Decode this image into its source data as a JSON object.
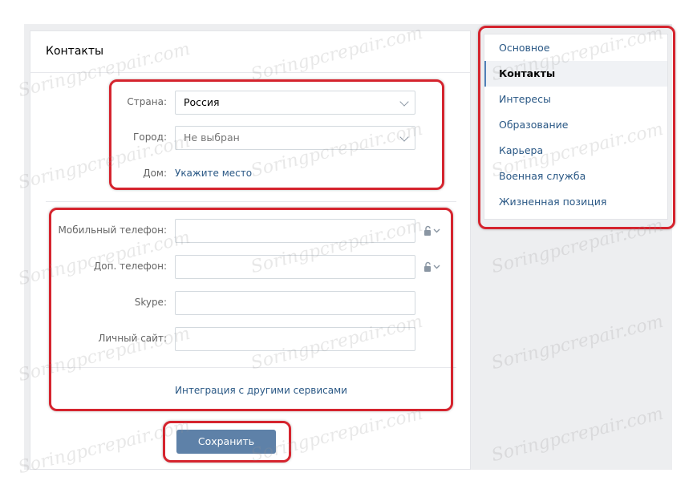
{
  "page": {
    "title": "Контакты"
  },
  "location": {
    "country_label": "Страна:",
    "country_value": "Россия",
    "city_label": "Город:",
    "city_placeholder": "Не выбран",
    "home_label": "Дом:",
    "home_link": "Укажите место"
  },
  "contacts": {
    "mobile_label": "Мобильный телефон:",
    "extra_phone_label": "Доп. телефон:",
    "skype_label": "Skype:",
    "site_label": "Личный сайт:",
    "integration_link": "Интеграция с другими сервисами"
  },
  "actions": {
    "save_label": "Сохранить"
  },
  "sidebar": {
    "items": [
      {
        "label": "Основное",
        "active": false
      },
      {
        "label": "Контакты",
        "active": true
      },
      {
        "label": "Интересы",
        "active": false
      },
      {
        "label": "Образование",
        "active": false
      },
      {
        "label": "Карьера",
        "active": false
      },
      {
        "label": "Военная служба",
        "active": false
      },
      {
        "label": "Жизненная позиция",
        "active": false
      }
    ]
  },
  "watermark": {
    "text": "Soringpcrepair.com"
  },
  "colors": {
    "accent": "#5181b8",
    "link": "#2a5885",
    "button": "#5e81a8",
    "highlight_frame": "#d5242e"
  }
}
